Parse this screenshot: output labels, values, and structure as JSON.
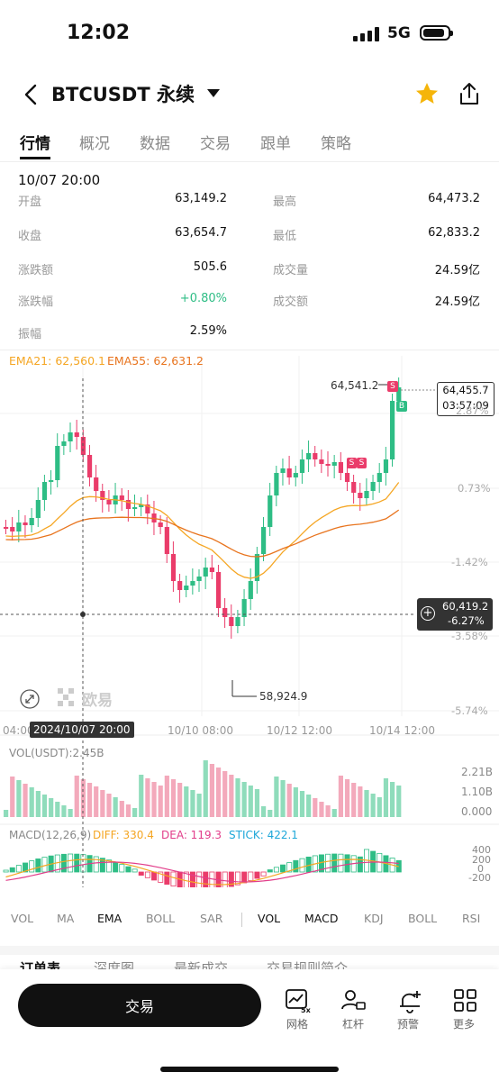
{
  "status_bar": {
    "time": "12:02",
    "network": "5G"
  },
  "header": {
    "title": "BTCUSDT 永续"
  },
  "tabs": [
    "行情",
    "概况",
    "数据",
    "交易",
    "跟单",
    "策略"
  ],
  "stats": {
    "datetime": "10/07 20:00",
    "left": [
      {
        "label": "开盘",
        "value": "63,149.2"
      },
      {
        "label": "收盘",
        "value": "63,654.7"
      },
      {
        "label": "涨跌额",
        "value": "505.6"
      },
      {
        "label": "涨跌幅",
        "value": "+0.80%"
      },
      {
        "label": "振幅",
        "value": "2.59%"
      }
    ],
    "right": [
      {
        "label": "最高",
        "value": "64,473.2"
      },
      {
        "label": "最低",
        "value": "62,833.2"
      },
      {
        "label": "成交量",
        "value": "24.59亿"
      },
      {
        "label": "成交额",
        "value": "24.59亿"
      }
    ]
  },
  "chart": {
    "ema21_label": "EMA21: 62,560.1",
    "ema55_label": "EMA55: 62,631.2",
    "high_marker": "64,541.2",
    "low_marker": "58,924.9",
    "price_tag": "64,455.7",
    "countdown": "03:57:09",
    "crosshair_price": "60,419.2",
    "crosshair_pct": "-6.27%",
    "right_axis": [
      "2.87%",
      "0.73%",
      "-1.42%",
      "-3.58%",
      "-5.74%"
    ],
    "x_labels": [
      "04:00",
      "10/10 08:00",
      "10/12 12:00",
      "10/14 12:00"
    ],
    "crosshair_time": "2024/10/07 20:00",
    "watermark": "欧易",
    "signals": [
      "S",
      "S",
      "S",
      "B"
    ],
    "vol_label": "VOL(USDT):2.45B",
    "vol_axis": [
      "2.21B",
      "1.10B",
      "0.000"
    ],
    "macd_label": "MACD(12,26,9)",
    "diff_label": "DIFF: 330.4",
    "dea_label": "DEA: 119.3",
    "stick_label": "STICK: 422.1",
    "macd_axis": [
      "400",
      "200",
      "0",
      "-200"
    ],
    "colors": {
      "up": "#2ebd85",
      "down": "#ea3c6a",
      "ema21": "#f5a623",
      "ema55": "#e8741e",
      "diff": "#f5a623",
      "dea": "#e23d8a",
      "stick": "#1ea7d9"
    }
  },
  "indicators_main": [
    "VOL",
    "MA",
    "EMA",
    "BOLL",
    "SAR"
  ],
  "indicators_sub": [
    "VOL",
    "MACD",
    "KDJ",
    "BOLL",
    "RSI"
  ],
  "selected_main": "EMA",
  "selected_sub": [
    "VOL",
    "MACD"
  ],
  "bottom_tabs": [
    "订单表",
    "深度图",
    "最新成交",
    "交易规则简介"
  ],
  "trade_button": "交易",
  "bottom_actions": [
    {
      "label": "网格",
      "icon": "grid-chart-icon"
    },
    {
      "label": "杠杆",
      "icon": "leverage-icon"
    },
    {
      "label": "预警",
      "icon": "bell-plus-icon"
    },
    {
      "label": "更多",
      "icon": "more-grid-icon"
    }
  ]
}
